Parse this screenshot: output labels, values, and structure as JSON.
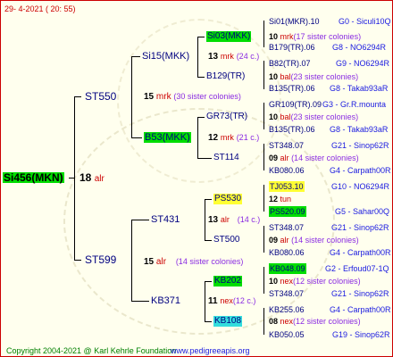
{
  "header": {
    "date": "29-  4-2021  ( 20:  55)"
  },
  "footer": {
    "copyright": "Copyright 2004-2021 @ Karl Kehrle Foundation",
    "site": "www.pedigreeapis.org"
  },
  "root": {
    "name": "Si456(MKN)",
    "num": "18",
    "tag": "alr"
  },
  "gen1": [
    {
      "name": "ST550",
      "num": "15",
      "tag": "mrk",
      "note": "(30 sister colonies)"
    },
    {
      "name": "ST599",
      "num": "15",
      "tag": "alr",
      "note": "(14 sister colonies)"
    }
  ],
  "gen2": [
    {
      "name": "Si15(MKK)",
      "num": "13",
      "tag": "mrk",
      "note": "(24 c.)"
    },
    {
      "name": "B53(MKK)",
      "num": "12",
      "tag": "mrk",
      "note": "(21 c.)"
    },
    {
      "name": "ST431",
      "num": "13",
      "tag": "alr",
      "note": "(14 c.)"
    },
    {
      "name": "KB371",
      "num": "11",
      "tag": "nex",
      "note": "(12 c.)"
    }
  ],
  "gen3": [
    {
      "name": "Si03(MKK)",
      "num": "10",
      "tag": "mrk",
      "note": "(17 sister colonies)"
    },
    {
      "name": "B129(TR)",
      "num": "10",
      "tag": "bal",
      "note": "(23 sister colonies)"
    },
    {
      "name": "GR73(TR)",
      "num": "10",
      "tag": "bal",
      "note": "(23 sister colonies)"
    },
    {
      "name": "ST114",
      "num": "09",
      "tag": "alr",
      "note": "(14 sister colonies)"
    },
    {
      "name": "PS530",
      "num": "12",
      "tag": "tun",
      "note": ""
    },
    {
      "name": "ST500",
      "num": "09",
      "tag": "alr",
      "note": "(14 sister colonies)"
    },
    {
      "name": "KB202",
      "num": "10",
      "tag": "nex",
      "note": "(12 sister colonies)"
    },
    {
      "name": "KB108",
      "num": "08",
      "tag": "nex",
      "note": "(12 sister colonies)"
    }
  ],
  "gen4": [
    {
      "name": "Si01(MKR).10",
      "info": "G0 - Siculi10Q"
    },
    {
      "name": "B179(TR).06",
      "info": "G8 - NO6294R"
    },
    {
      "name": "B82(TR).07",
      "info": "G9 - NO6294R"
    },
    {
      "name": "B135(TR).06",
      "info": "G8 - Takab93aR"
    },
    {
      "name": "GR109(TR).09",
      "info": "G3 - Gr.R.mounta"
    },
    {
      "name": "B135(TR).06",
      "info": "G8 - Takab93aR"
    },
    {
      "name": "ST348.07",
      "info": "G21 - Sinop62R"
    },
    {
      "name": "KB080.06",
      "info": "G4 - Carpath00R"
    },
    {
      "name": "TJ053.10",
      "info": "G10 - NO6294R"
    },
    {
      "name": "PS520.09",
      "info": "G5 - Sahar00Q"
    },
    {
      "name": "ST348.07",
      "info": "G21 - Sinop62R"
    },
    {
      "name": "KB080.06",
      "info": "G4 - Carpath00R"
    },
    {
      "name": "KB048.09",
      "info": "G2 - Erfoud07-1Q"
    },
    {
      "name": "ST348.07",
      "info": "G21 - Sinop62R"
    },
    {
      "name": "KB255.06",
      "info": "G4 - Carpath00R"
    },
    {
      "name": "KB050.05",
      "info": "G19 - Sinop62R"
    }
  ]
}
